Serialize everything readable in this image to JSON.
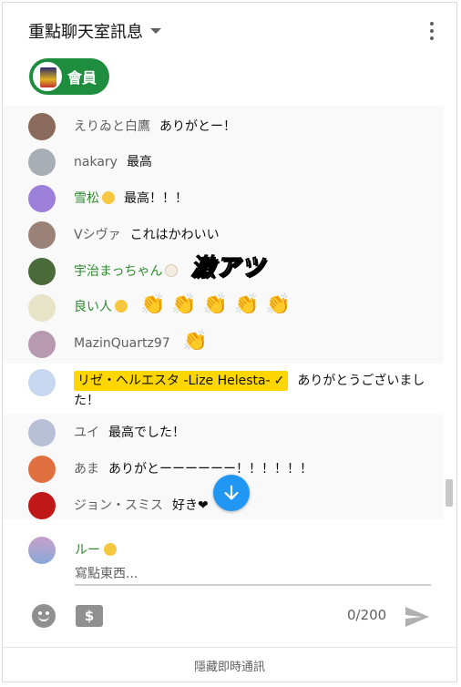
{
  "header": {
    "title": "重點聊天室訊息",
    "member_chip": "會員"
  },
  "messages": [
    {
      "author": "えりゐと白鷹",
      "text": "ありがとー！",
      "member": false,
      "avatar_color": "#8a6a5a"
    },
    {
      "author": "nakary",
      "text": "最高",
      "member": false,
      "avatar_color": "#a8aeb6"
    },
    {
      "author": "雪松",
      "text": "最高！！！",
      "member": true,
      "badge": "chick",
      "avatar_color": "#9b7fd8"
    },
    {
      "author": "Vシヴァ",
      "text": "これはかわいい",
      "member": false,
      "avatar_color": "#9b8278"
    },
    {
      "author": "宇治まっちゃん",
      "text": "激アツ",
      "member": true,
      "badge": "egg",
      "avatar_color": "#4a6a3a"
    },
    {
      "author": "良い人",
      "text": "👏 👏 👏 👏 👏",
      "member": true,
      "badge": "chick",
      "avatar_color": "#e8e4c8"
    },
    {
      "author": "MazinQuartz97",
      "text": "👏",
      "member": false,
      "avatar_color": "#b89ab0"
    },
    {
      "author": "リゼ・ヘルエスタ -Lize Helesta-",
      "owner_check": "✓",
      "text": "ありがとうございました！",
      "owner": true,
      "avatar_color": "#c8d8f0"
    },
    {
      "author": "ユイ",
      "text": "最高でした！",
      "member": false,
      "avatar_color": "#b8c0d8"
    },
    {
      "author": "あま",
      "text": "ありがとーーーーーー！！！！！！",
      "member": false,
      "avatar_color": "#e07040"
    },
    {
      "author": "ジョン・スミス",
      "text": "好き❤",
      "member": false,
      "avatar_color": "#c01818"
    }
  ],
  "input": {
    "user_name": "ルー",
    "placeholder": "寫點東西...",
    "counter": "0/200",
    "money_glyph": "$"
  },
  "footer": {
    "label": "隱藏即時通訊"
  },
  "colors": {
    "member_green": "#2e8b2e",
    "chip_green": "#1e8e3e",
    "owner_yellow": "#ffd600",
    "jump_blue": "#2196f3"
  }
}
